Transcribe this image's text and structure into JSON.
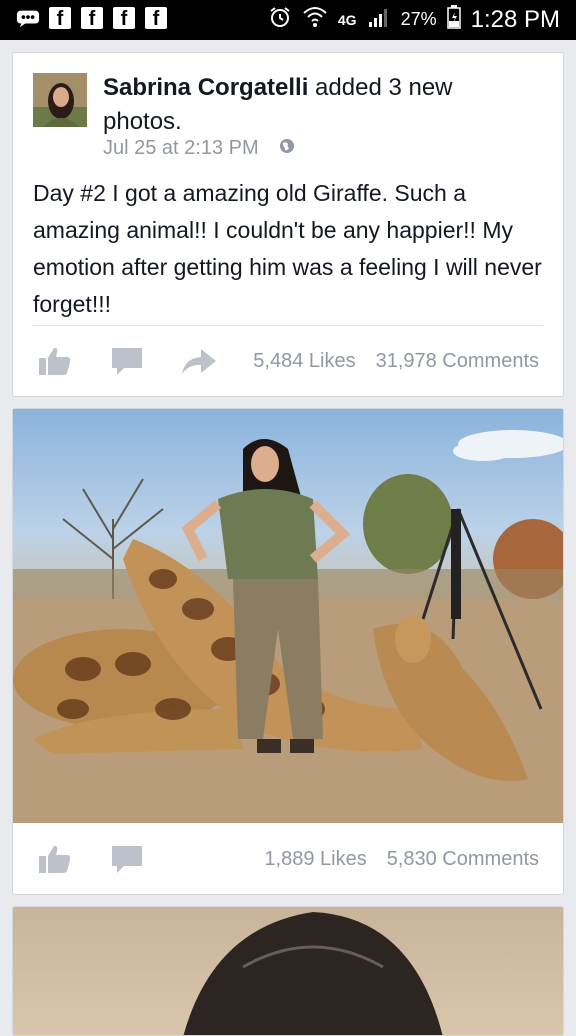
{
  "status_bar": {
    "icons": [
      "messenger-icon",
      "facebook-icon",
      "facebook-icon",
      "facebook-icon",
      "facebook-icon"
    ],
    "network": "4G",
    "battery": "27%",
    "time": "1:28 PM"
  },
  "post": {
    "author": "Sabrina Corgatelli",
    "action": " added 3 new photos.",
    "timestamp": "Jul 25 at 2:13 PM",
    "privacy_icon": "globe-icon",
    "text": "Day #2 I got a amazing old Giraffe.  Such a amazing animal!!  I couldn't be any happier!! My emotion after getting him was a feeling I will never forget!!!",
    "likes": "5,484 Likes",
    "comments": "31,978 Comments"
  },
  "photo_post": {
    "likes": "1,889 Likes",
    "comments": "5,830 Comments"
  },
  "colors": {
    "facebook_gray": "#9197a3",
    "background": "#e9eaed"
  }
}
